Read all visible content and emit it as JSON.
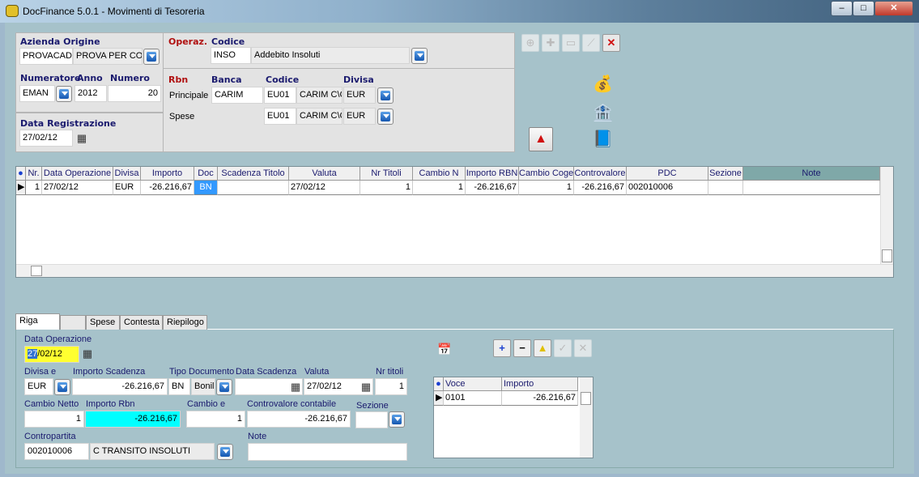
{
  "window": {
    "title": "DocFinance 5.0.1  - Movimenti di Tesoreria",
    "min": "–",
    "max": "□",
    "close": "✕"
  },
  "header": {
    "azienda_label": "Azienda Origine",
    "azienda_code": "PROVACAD",
    "azienda_name": "PROVA PER CO",
    "numeratore_label": "Numeratore",
    "anno_label": "Anno",
    "numero_label": "Numero",
    "numeratore": "EMAN",
    "anno": "2012",
    "numero": "20",
    "data_reg_label": "Data Registrazione",
    "data_reg": "27/02/12",
    "operaz_label": "Operaz.",
    "codice_label": "Codice",
    "op_code": "INSO",
    "op_desc": "Addebito Insoluti",
    "rbn_label": "Rbn",
    "banca_label": "Banca",
    "codice2_label": "Codice",
    "divisa_label": "Divisa",
    "principale_label": "Principale",
    "spese_label": "Spese",
    "principale": {
      "banca": "CARIM",
      "codice": "EU01",
      "desc": "CARIM C\\C",
      "divisa": "EUR"
    },
    "spese": {
      "codice": "EU01",
      "desc": "CARIM C\\C",
      "divisa": "EUR"
    }
  },
  "grid": {
    "columns": [
      "Nr.",
      "Data Operazione",
      "Divisa",
      "Importo",
      "Doc",
      "Scadenza Titolo",
      "Valuta",
      "Nr Titoli",
      "Cambio N",
      "Importo RBN",
      "Cambio Coge",
      "Controvalore",
      "PDC",
      "Sezione",
      "Note"
    ],
    "rows": [
      [
        "1",
        "27/02/12",
        "EUR",
        "-26.216,67",
        "BN",
        "",
        "27/02/12",
        "1",
        "1",
        "-26.216,67",
        "1",
        "-26.216,67",
        "002010006",
        "",
        ""
      ]
    ]
  },
  "tabs": [
    "Riga",
    "",
    "Spese",
    "Contesta",
    "Riepilogo"
  ],
  "detail": {
    "data_op_label": "Data Operazione",
    "data_op": "27/02/12",
    "divisa_label": "Divisa   e",
    "imp_scad_label": "Importo Scadenza",
    "tipo_doc_label": "Tipo Documento",
    "data_scad_label": "Data Scadenza",
    "valuta_label": "Valuta",
    "nr_titoli_label": "Nr titoli",
    "divisa": "EUR",
    "imp_scad": "-26.216,67",
    "tipo_doc": "BN",
    "tipo_doc_desc": "Bonil",
    "data_scad": "",
    "valuta": "27/02/12",
    "nr_titoli": "1",
    "cambio_netto_label": "Cambio Netto",
    "importo_rbn_label": "Importo Rbn",
    "cambio_label": "Cambio     e",
    "controvalore_label": "Controvalore contabile",
    "sezione_label": "Sezione",
    "cambio_netto": "1",
    "importo_rbn": "-26.216,67",
    "cambio": "1",
    "controvalore": "-26.216,67",
    "sezione": "",
    "contropartita_label": "Contropartita",
    "contropartita_code": "002010006",
    "contropartita_desc": "C TRANSITO INSOLUTI",
    "note_label": "Note",
    "note": ""
  },
  "voci": {
    "columns": [
      "Voce",
      "Importo"
    ],
    "rows": [
      [
        "0101",
        "-26.216,67"
      ]
    ]
  }
}
